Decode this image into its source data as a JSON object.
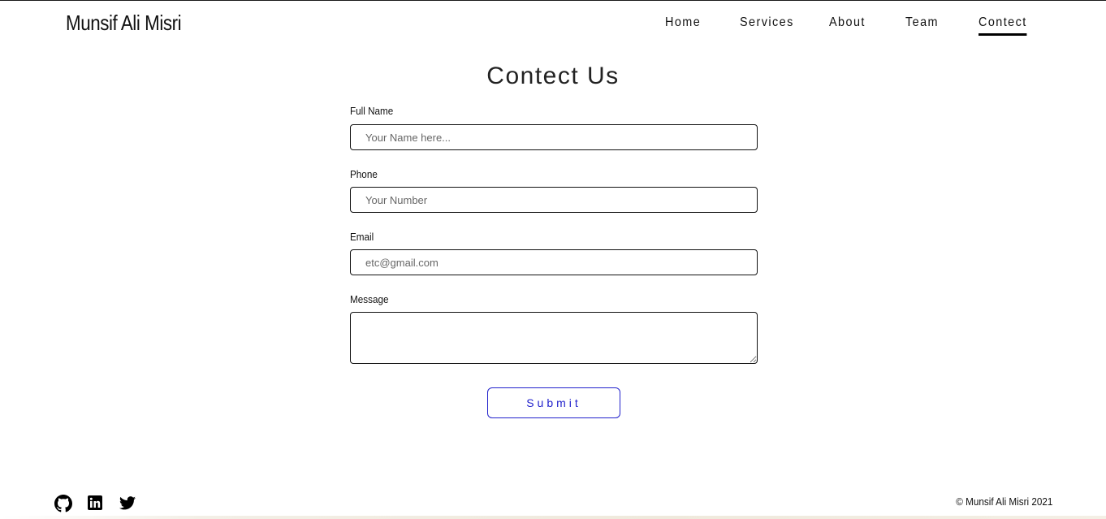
{
  "brand": {
    "name": "Munsif Ali Misri"
  },
  "nav": {
    "items": [
      {
        "label": "Home"
      },
      {
        "label": "Services"
      },
      {
        "label": "About"
      },
      {
        "label": "Team"
      },
      {
        "label": "Contect",
        "active": true
      }
    ]
  },
  "form": {
    "title": "Contect Us",
    "fields": [
      {
        "label": "Full Name",
        "placeholder": "Your Name here...",
        "value": ""
      },
      {
        "label": "Phone",
        "placeholder": "Your Number",
        "value": ""
      },
      {
        "label": "Email",
        "placeholder": "etc@gmail.com",
        "value": ""
      },
      {
        "label": "Message",
        "placeholder": "",
        "value": ""
      }
    ],
    "submit_label": "Submit"
  },
  "footer": {
    "social": [
      "github-icon",
      "linkedin-icon",
      "twitter-icon"
    ],
    "copyright": "© Munsif Ali Misri 2021"
  },
  "colors": {
    "accent": "#2222cc",
    "text": "#111111",
    "background": "#ffffff"
  }
}
